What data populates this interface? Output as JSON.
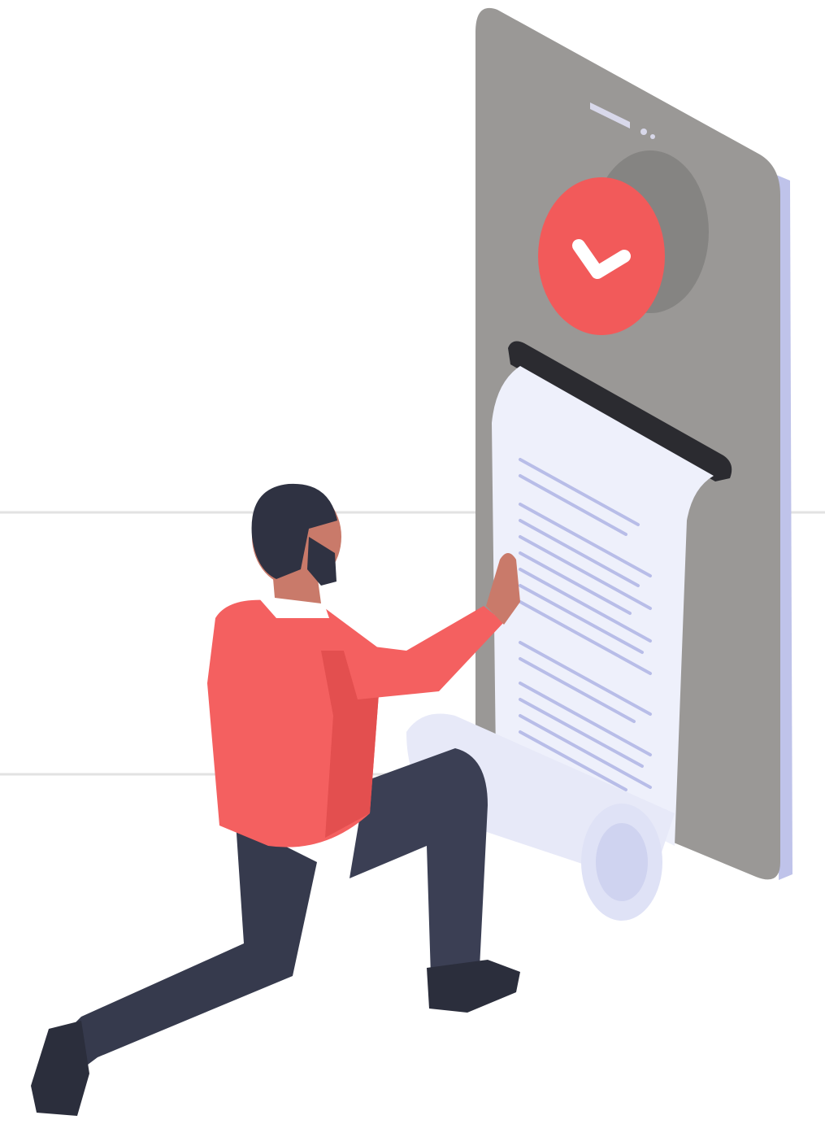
{
  "illustration": {
    "subject": "receipt-illustration",
    "icons": [
      "checkmark-icon"
    ],
    "colors": {
      "background": "#ffffff",
      "guide_line": "#e2e2e2",
      "phone_body": "#9a9896",
      "phone_edge": "#bfc3ea",
      "phone_speaker": "#d8d8ea",
      "check_badge": "#f25a5a",
      "check_badge_shadow": "#858482",
      "receipt_paper": "#eef0fb",
      "receipt_lines": "#b8bde8",
      "receipt_roll": "#dfe2f6",
      "printer_slot": "#2b2b30",
      "shirt": "#f46060",
      "shirt_shade": "#e34f4f",
      "collar": "#ffffff",
      "skin": "#c97a6a",
      "hair": "#2f3242",
      "pants": "#363a4d",
      "shoes": "#2b2e3c"
    }
  }
}
